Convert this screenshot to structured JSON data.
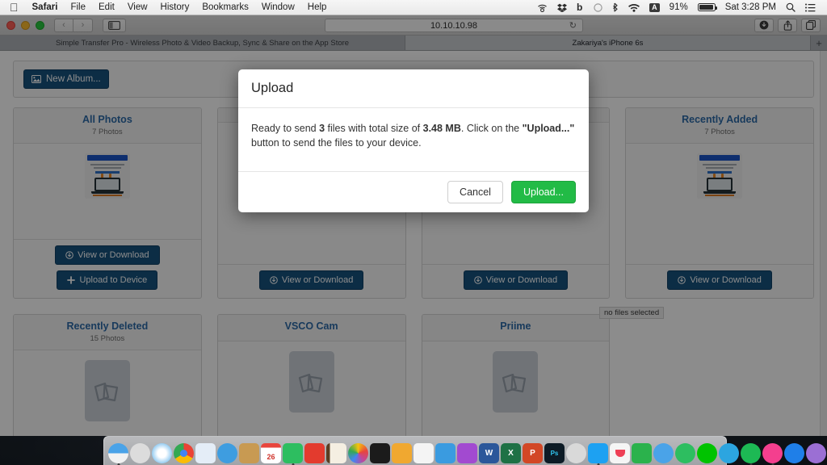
{
  "menubar": {
    "apple_icon": "apple-logo-icon",
    "items": [
      {
        "label": "Safari",
        "bold": true
      },
      {
        "label": "File",
        "bold": false
      },
      {
        "label": "Edit",
        "bold": false
      },
      {
        "label": "View",
        "bold": false
      },
      {
        "label": "History",
        "bold": false
      },
      {
        "label": "Bookmarks",
        "bold": false
      },
      {
        "label": "Window",
        "bold": false
      },
      {
        "label": "Help",
        "bold": false
      }
    ],
    "status": {
      "airplay_icon": "airplay-audio-icon",
      "dropbox_icon": "dropbox-icon",
      "bartender_icon": "bartender-b-icon",
      "circle_icon": "circle-icon",
      "bluetooth_icon": "bluetooth-icon",
      "wifi_icon": "wifi-icon",
      "input_source": "A",
      "battery_percent": "91%",
      "battery_icon": "battery-icon",
      "clock": "Sat 3:28 PM",
      "search_icon": "spotlight-search-icon",
      "notification_icon": "notification-center-icon"
    }
  },
  "safari": {
    "window_controls": {
      "close": "close-window-button",
      "minimize": "minimize-window-button",
      "zoom": "zoom-window-button"
    },
    "back_label": "‹",
    "forward_label": "›",
    "sidebar_icon": "sidebar-toggle-icon",
    "url": "10.10.10.98",
    "reload_label": "↻",
    "toolbar_right": [
      {
        "name": "downloads-button",
        "glyph": "⬇"
      },
      {
        "name": "share-button",
        "glyph": "⇧"
      },
      {
        "name": "show-tabs-button",
        "glyph": "⧉"
      }
    ],
    "tabs": [
      {
        "label": "Simple Transfer Pro - Wireless Photo & Video Backup, Sync & Share on the App Store",
        "active": false
      },
      {
        "label": "Zakariya's iPhone 6s",
        "active": true
      }
    ],
    "new_tab_label": "+"
  },
  "page": {
    "new_album_button": {
      "label": "New Album...",
      "icon": "image-icon"
    },
    "albums": [
      {
        "title": "All Photos",
        "count": "7 Photos",
        "thumb_type": "screenshot",
        "actions": [
          {
            "label": "View or Download",
            "icon": "download-circle-icon"
          },
          {
            "label": "Upload to Device",
            "icon": "plus-icon"
          }
        ],
        "status": ""
      },
      {
        "title": "",
        "count": "",
        "thumb_type": "screenshot",
        "actions": [
          {
            "label": "View or Download",
            "icon": "download-circle-icon"
          }
        ],
        "status": ""
      },
      {
        "title": "",
        "count": "",
        "thumb_type": "screenshot",
        "actions": [
          {
            "label": "View or Download",
            "icon": "download-circle-icon"
          }
        ],
        "status": ""
      },
      {
        "title": "Recently Added",
        "count": "7 Photos",
        "thumb_type": "screenshot",
        "actions": [
          {
            "label": "View or Download",
            "icon": "download-circle-icon"
          }
        ],
        "status": "no files selected"
      },
      {
        "title": "Recently Deleted",
        "count": "15 Photos",
        "thumb_type": "placeholder",
        "actions": [],
        "status": ""
      },
      {
        "title": "VSCO Cam",
        "count": "",
        "thumb_type": "placeholder",
        "actions": [],
        "status": ""
      },
      {
        "title": "Priime",
        "count": "",
        "thumb_type": "placeholder",
        "actions": [],
        "status": ""
      },
      {
        "title": "",
        "count": "",
        "thumb_type": "none",
        "actions": [],
        "status": ""
      }
    ]
  },
  "modal": {
    "title": "Upload",
    "body_parts": [
      {
        "text": "Ready to send ",
        "bold": false
      },
      {
        "text": "3",
        "bold": true
      },
      {
        "text": " files with total size of ",
        "bold": false
      },
      {
        "text": "3.48 MB",
        "bold": true
      },
      {
        "text": ". Click on the ",
        "bold": false
      },
      {
        "text": "\"Upload...\"",
        "bold": true
      },
      {
        "text": " button to send the files to your device.",
        "bold": false
      }
    ],
    "cancel_label": "Cancel",
    "upload_label": "Upload...",
    "upload_color": "#22bb46"
  },
  "dock": {
    "icons": [
      {
        "name": "finder",
        "color": "#4aa3e8",
        "glyph": ""
      },
      {
        "name": "launchpad",
        "color": "#d8d8d8",
        "glyph": "🚀"
      },
      {
        "name": "safari",
        "color": "#e8f2fb",
        "glyph": ""
      },
      {
        "name": "chrome",
        "color": "#f5f5f5",
        "glyph": ""
      },
      {
        "name": "preview",
        "color": "#dfe9f5",
        "glyph": ""
      },
      {
        "name": "mail",
        "color": "#3e9de0",
        "glyph": ""
      },
      {
        "name": "contacts",
        "color": "#c89a52",
        "glyph": ""
      },
      {
        "name": "calendar",
        "color": "#f2f2f2",
        "glyph": "26"
      },
      {
        "name": "evernote",
        "color": "#2dbe60",
        "glyph": ""
      },
      {
        "name": "sublime-text",
        "color": "#e33b2e",
        "glyph": ""
      },
      {
        "name": "notes",
        "color": "#f0a830",
        "glyph": ""
      },
      {
        "name": "photos",
        "color": "#f7f7f7",
        "glyph": ""
      },
      {
        "name": "transmit",
        "color": "#1b1b1b",
        "glyph": ""
      },
      {
        "name": "pages",
        "color": "#f0a830",
        "glyph": ""
      },
      {
        "name": "numbers",
        "color": "#f5f5f5",
        "glyph": ""
      },
      {
        "name": "keynote",
        "color": "#3a9be0",
        "glyph": ""
      },
      {
        "name": "omnigraffle",
        "color": "#a24ad0",
        "glyph": ""
      },
      {
        "name": "word",
        "color": "#2b579a",
        "glyph": "W"
      },
      {
        "name": "excel",
        "color": "#1e7145",
        "glyph": "X"
      },
      {
        "name": "powerpoint",
        "color": "#d24726",
        "glyph": "P"
      },
      {
        "name": "photoshop",
        "color": "#0d1b26",
        "glyph": "Ps"
      },
      {
        "name": "skitch",
        "color": "#d9d9d9",
        "glyph": ""
      },
      {
        "name": "twitter",
        "color": "#1da1f2",
        "glyph": ""
      },
      {
        "name": "pocket",
        "color": "#f5f5f5",
        "glyph": ""
      },
      {
        "name": "feedly",
        "color": "#2bb24c",
        "glyph": ""
      },
      {
        "name": "messages",
        "color": "#4aa3e8",
        "glyph": ""
      },
      {
        "name": "facetime",
        "color": "#2dbe60",
        "glyph": ""
      },
      {
        "name": "line",
        "color": "#00c300",
        "glyph": ""
      },
      {
        "name": "telegram",
        "color": "#2ca5e0",
        "glyph": ""
      },
      {
        "name": "spotify",
        "color": "#1db954",
        "glyph": ""
      },
      {
        "name": "itunes",
        "color": "#f43f8e",
        "glyph": ""
      },
      {
        "name": "app-store",
        "color": "#1f7fe8",
        "glyph": ""
      },
      {
        "name": "bittorrent",
        "color": "#9b6fd4",
        "glyph": ""
      },
      {
        "name": "cleanmymac",
        "color": "#7a7a7a",
        "glyph": ""
      }
    ],
    "right_icons": [
      {
        "name": "downloads-stack",
        "color": "#3c3c46",
        "glyph": ""
      },
      {
        "name": "trash",
        "color": "#e8eaec",
        "glyph": ""
      }
    ]
  }
}
